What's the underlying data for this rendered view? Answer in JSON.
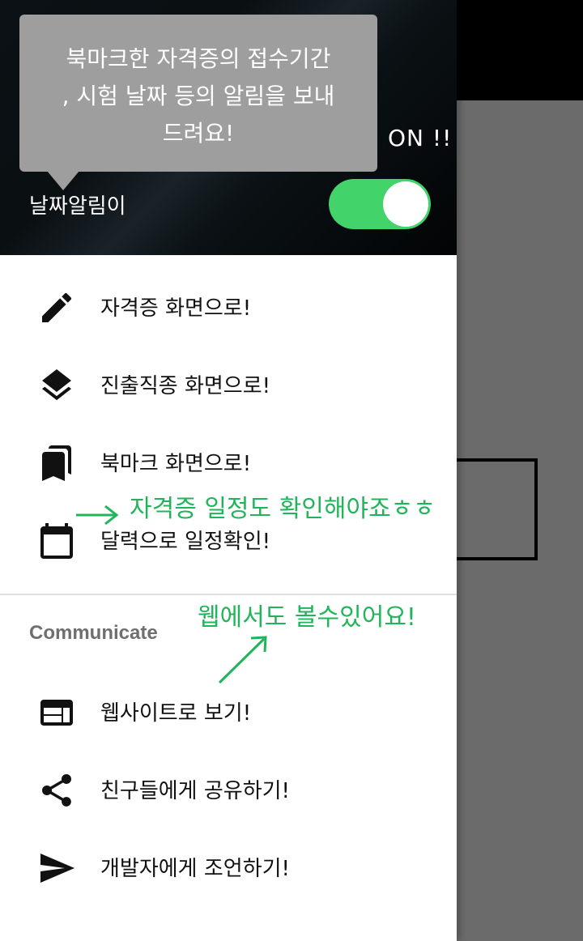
{
  "header": {
    "on_text": "ON !!",
    "label": "날짜알림이",
    "toggle_state": "on",
    "toggle_color": "#42d36a"
  },
  "tooltip": {
    "lines": [
      "북마크한 자격증의 접수기간",
      ", 시험 날짜 등의 알림을 보내",
      "드려요!"
    ]
  },
  "menu": {
    "items": [
      {
        "label": "자격증 화면으로!",
        "icon": "pencil-icon"
      },
      {
        "label": "진출직종 화면으로!",
        "icon": "layers-icon"
      },
      {
        "label": "북마크 화면으로!",
        "icon": "bookmarks-icon"
      },
      {
        "label": "달력으로 일정확인!",
        "icon": "calendar-icon"
      }
    ]
  },
  "communicate": {
    "title": "Communicate",
    "items": [
      {
        "label": "웹사이트로 보기!",
        "icon": "web-icon"
      },
      {
        "label": "친구들에게 공유하기!",
        "icon": "share-icon"
      },
      {
        "label": "개발자에게 조언하기!",
        "icon": "send-icon"
      }
    ]
  },
  "annotations": {
    "calendar_note": "자격증 일정도 확인해야죠ㅎㅎ",
    "web_note": "웹에서도 볼수있어요!",
    "color": "#21b55b"
  }
}
